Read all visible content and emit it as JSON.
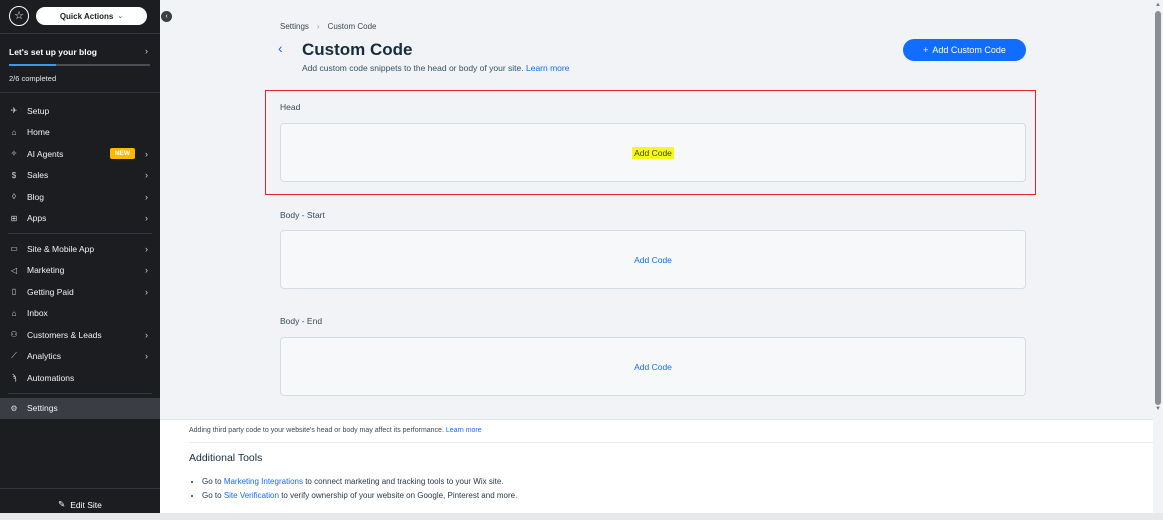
{
  "sidebar": {
    "quick_actions": "Quick Actions",
    "setup_title": "Let's set up your blog",
    "setup_progress": "2/6 completed",
    "setup_progress_fraction": 0.333,
    "items": [
      {
        "label": "Setup",
        "icon": "rocket-icon",
        "glyph": "✈"
      },
      {
        "label": "Home",
        "icon": "home-icon",
        "glyph": "⌂"
      },
      {
        "label": "AI Agents",
        "icon": "sparkle-icon",
        "glyph": "✧",
        "badge": "NEW"
      },
      {
        "label": "Sales",
        "icon": "dollar-icon",
        "glyph": "$"
      },
      {
        "label": "Blog",
        "icon": "pen-nib-icon",
        "glyph": "◊"
      },
      {
        "label": "Apps",
        "icon": "apps-icon",
        "glyph": "⊞"
      },
      {
        "label": "Site & Mobile App",
        "icon": "monitor-icon",
        "glyph": "▭"
      },
      {
        "label": "Marketing",
        "icon": "megaphone-icon",
        "glyph": "◁"
      },
      {
        "label": "Getting Paid",
        "icon": "receipt-icon",
        "glyph": "▯"
      },
      {
        "label": "Inbox",
        "icon": "inbox-icon",
        "glyph": "⌂"
      },
      {
        "label": "Customers & Leads",
        "icon": "contacts-icon",
        "glyph": "⚇"
      },
      {
        "label": "Analytics",
        "icon": "chart-icon",
        "glyph": "⟋"
      },
      {
        "label": "Automations",
        "icon": "automation-icon",
        "glyph": "ϡ"
      },
      {
        "label": "Settings",
        "icon": "gear-icon",
        "glyph": "⚙"
      }
    ],
    "edit_site": "Edit Site"
  },
  "header": {
    "breadcrumb_root": "Settings",
    "breadcrumb_current": "Custom Code",
    "title": "Custom Code",
    "subtitle": "Add custom code snippets to the head or body of your site.",
    "learn_more": "Learn more",
    "add_button": "Add Custom Code"
  },
  "sections": [
    {
      "label": "Head",
      "action": "Add Code"
    },
    {
      "label": "Body - Start",
      "action": "Add Code"
    },
    {
      "label": "Body - End",
      "action": "Add Code"
    }
  ],
  "footer": {
    "note": "Adding third party code to your website's head or body may affect its performance.",
    "note_link": "Learn more",
    "tools_title": "Additional Tools",
    "tool1_prefix": "Go to",
    "tool1_link": "Marketing Integrations",
    "tool1_suffix": "to connect marketing and tracking tools to your Wix site.",
    "tool2_prefix": "Go to",
    "tool2_link": "Site Verification",
    "tool2_suffix": "to verify ownership of your website on Google, Pinterest and more."
  },
  "colors": {
    "sidebar_bg": "#1b1d21",
    "accent": "#116dff",
    "highlight": "#f7f71a",
    "focus_frame": "#e0262b"
  }
}
